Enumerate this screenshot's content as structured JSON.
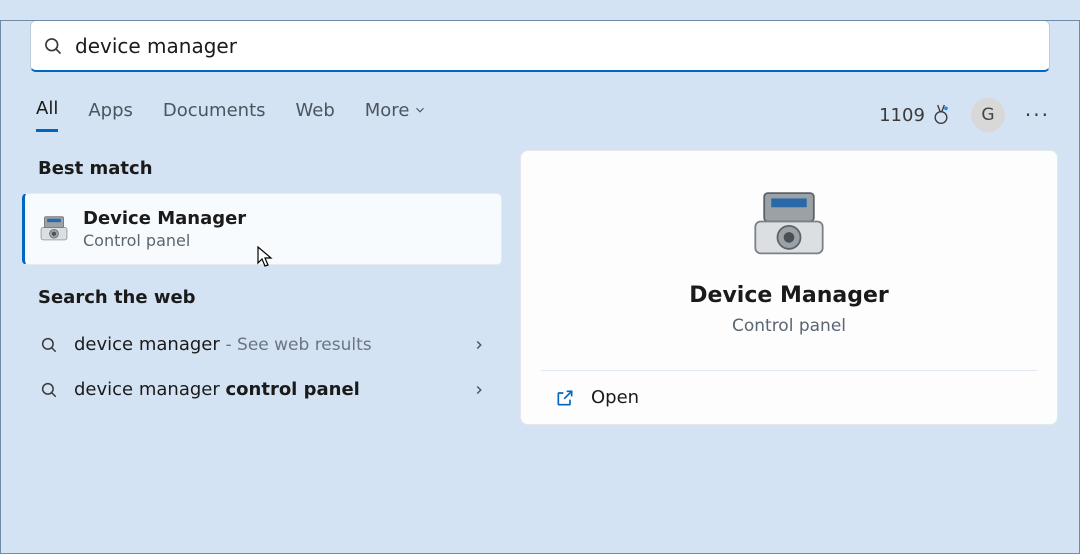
{
  "search": {
    "query": "device manager"
  },
  "tabs": {
    "all": "All",
    "apps": "Apps",
    "documents": "Documents",
    "web": "Web",
    "more": "More"
  },
  "header": {
    "points": "1109",
    "avatar_initial": "G"
  },
  "sections": {
    "best_match": "Best match",
    "search_web": "Search the web"
  },
  "best_match": {
    "title": "Device Manager",
    "subtitle": "Control panel"
  },
  "web_results": [
    {
      "label": "device manager",
      "hint": "- See web results"
    },
    {
      "label_prefix": "device manager ",
      "label_bold": "control panel",
      "hint": ""
    }
  ],
  "details": {
    "title": "Device Manager",
    "subtitle": "Control panel",
    "open": "Open"
  }
}
